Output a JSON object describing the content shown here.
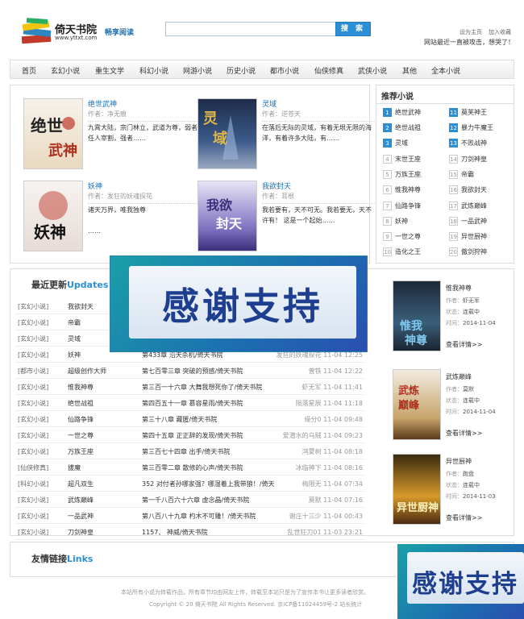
{
  "header": {
    "site_title": "倚天书院",
    "site_url": "www.yttxt.com",
    "slogan": "畅享阅读",
    "search_placeholder": "",
    "search_button": "搜 索",
    "set_home": "设为主页",
    "add_favorite": "加入收藏",
    "notice": "网站最近一直被攻击，想哭了！"
  },
  "nav": [
    "首页",
    "玄幻小说",
    "重生文学",
    "科幻小说",
    "网游小说",
    "历史小说",
    "都市小说",
    "仙侠修真",
    "武侠小说",
    "其他",
    "全本小说"
  ],
  "featured": [
    {
      "title": "绝世武神",
      "author": "作者：净无痕",
      "desc": "九霄大陆，宗门林立，武道为尊，弱者任人宰割，强者……",
      "cover": "绝世武神"
    },
    {
      "title": "灵域",
      "author": "作者：逆苍天",
      "desc": "在落后无际的灵域，有着无垠无限的海洋，有着许多大陆，有……",
      "cover": "灵域"
    },
    {
      "title": "妖神",
      "author": "作者：发狂的妖魂探花",
      "desc": "诸天万界，唯我独尊",
      "desc2": "……",
      "cover": "妖神"
    },
    {
      "title": "我欲封天",
      "author": "作者：耳根",
      "desc": "我若要有，天不可无。我若要无，天不许有！ 这是一个起始……",
      "cover": "我欲封天"
    }
  ],
  "recommend": {
    "title": "推荐小说",
    "left": [
      {
        "n": "1",
        "name": "绝世武神"
      },
      {
        "n": "2",
        "name": "绝世战祖"
      },
      {
        "n": "3",
        "name": "灵域"
      },
      {
        "n": "4",
        "name": "末世王座"
      },
      {
        "n": "5",
        "name": "万族王座"
      },
      {
        "n": "6",
        "name": "惟我神尊"
      },
      {
        "n": "7",
        "name": "仙路争锋"
      },
      {
        "n": "8",
        "name": "妖神"
      },
      {
        "n": "9",
        "name": "一世之尊"
      },
      {
        "n": "10",
        "name": "造化之王"
      }
    ],
    "right": [
      {
        "n": "11",
        "name": "莫芙神王"
      },
      {
        "n": "12",
        "name": "暴力牛魔王"
      },
      {
        "n": "13",
        "name": "不败战神"
      },
      {
        "n": "14",
        "name": "刀剑神皇"
      },
      {
        "n": "15",
        "name": "帝霸"
      },
      {
        "n": "16",
        "name": "我欲封天"
      },
      {
        "n": "17",
        "name": "武炼巅峰"
      },
      {
        "n": "18",
        "name": "一品武神"
      },
      {
        "n": "19",
        "name": "异世厨神"
      },
      {
        "n": "20",
        "name": "傲剑狩神"
      }
    ]
  },
  "updates": {
    "title_cn": "最近更新",
    "title_en": "Updates",
    "rows": [
      {
        "cat": "[玄幻小说]",
        "book": "我欲封天",
        "chapter": "",
        "meta": ""
      },
      {
        "cat": "[玄幻小说]",
        "book": "帝霸",
        "chapter": "",
        "meta": ""
      },
      {
        "cat": "[玄幻小说]",
        "book": "灵域",
        "chapter": "",
        "meta": ""
      },
      {
        "cat": "[玄幻小说]",
        "book": "妖神",
        "chapter": "第433章 沿天杀机/倚天书院",
        "meta": "发狂的妖魂探花 11-04 12:25"
      },
      {
        "cat": "[都市小说]",
        "book": "超级创作大师",
        "chapter": "第七百零三章 突破的预感/倚天书院",
        "meta": "曾铁 11-04 12:22"
      },
      {
        "cat": "[玄幻小说]",
        "book": "惟我神尊",
        "chapter": "第三百一十六章 大舞我想死你了/倚天书院",
        "meta": "虾无军 11-04 11:41"
      },
      {
        "cat": "[玄幻小说]",
        "book": "绝世战祖",
        "chapter": "第四百五十一章 慕容星雨/倚天书院",
        "meta": "陨落星辰 11-04 11:18"
      },
      {
        "cat": "[玄幻小说]",
        "book": "仙路争锋",
        "chapter": "第三十八章 藏匿/倚天书院",
        "meta": "缘分0 11-04 09:48"
      },
      {
        "cat": "[玄幻小说]",
        "book": "一世之尊",
        "chapter": "第四十五章 正正辞的发现/倚天书院",
        "meta": "爱潜水的乌贼 11-04 09:23"
      },
      {
        "cat": "[玄幻小说]",
        "book": "万族王座",
        "chapter": "第三百七十四章 出手/倚天书院",
        "meta": "鸿蒙树 11-04 08:18"
      },
      {
        "cat": "[仙侠修真]",
        "book": "拔魔",
        "chapter": "第三百零二章 散修的心声/倚天书院",
        "meta": "冰临神下 11-04 08:16"
      },
      {
        "cat": "[科幻小说]",
        "book": "超凡双生",
        "chapter": "352 对付者孙哪家强？哪湿着上我带狼！/倚天",
        "meta": "梅限无 11-04 07:34"
      },
      {
        "cat": "[玄幻小说]",
        "book": "武炼巅峰",
        "chapter": "第一千八百六十六章 虚念晶/倚天书院",
        "meta": "莫默 11-04 07:16"
      },
      {
        "cat": "[玄幻小说]",
        "book": "一品武神",
        "chapter": "第八百八十九章 杓木不可雕！/倚天书院",
        "meta": "谢庄十三少 11-04 00:43"
      },
      {
        "cat": "[玄幻小说]",
        "book": "刀剑神皇",
        "chapter": "1157、 神威/倚天书院",
        "meta": "乱世狂刀01 11-03 23:21"
      }
    ]
  },
  "sidebar_books": [
    {
      "name": "惟我神尊",
      "author_label": "作者：",
      "author": "虾无军",
      "status_label": "状态：",
      "status": "连载中",
      "time_label": "时间：",
      "time": "2014-11-04",
      "more": "查看详情>>",
      "cover": "惟我神尊"
    },
    {
      "name": "武炼巅峰",
      "author_label": "作者：",
      "author": "莫默",
      "status_label": "状态：",
      "status": "连载中",
      "time_label": "时间：",
      "time": "2014-11-04",
      "more": "查看详情>>",
      "cover": "武炼巅峰"
    },
    {
      "name": "异世厨神",
      "author_label": "作者：",
      "author": "跑盘",
      "status_label": "状态：",
      "status": "连载中",
      "time_label": "时间：",
      "time": "2014-11-03",
      "more": "查看详情>>",
      "cover": "异世厨神"
    }
  ],
  "links": {
    "title_cn": "友情链接",
    "title_en": "Links"
  },
  "footer": {
    "line1": "本站所有小说为转载作品，所有章节均由网友上传，转载至本站只是为了宣传本书让更多读者欣赏。",
    "line2": "Copyright © 20 倚天书院 All Rights Reserved. 京ICP备11024459号-2 站长统计"
  },
  "overlay_text": "感谢支持",
  "colors": {
    "accent": "#2b8fd6",
    "link": "#1a6fb0"
  }
}
